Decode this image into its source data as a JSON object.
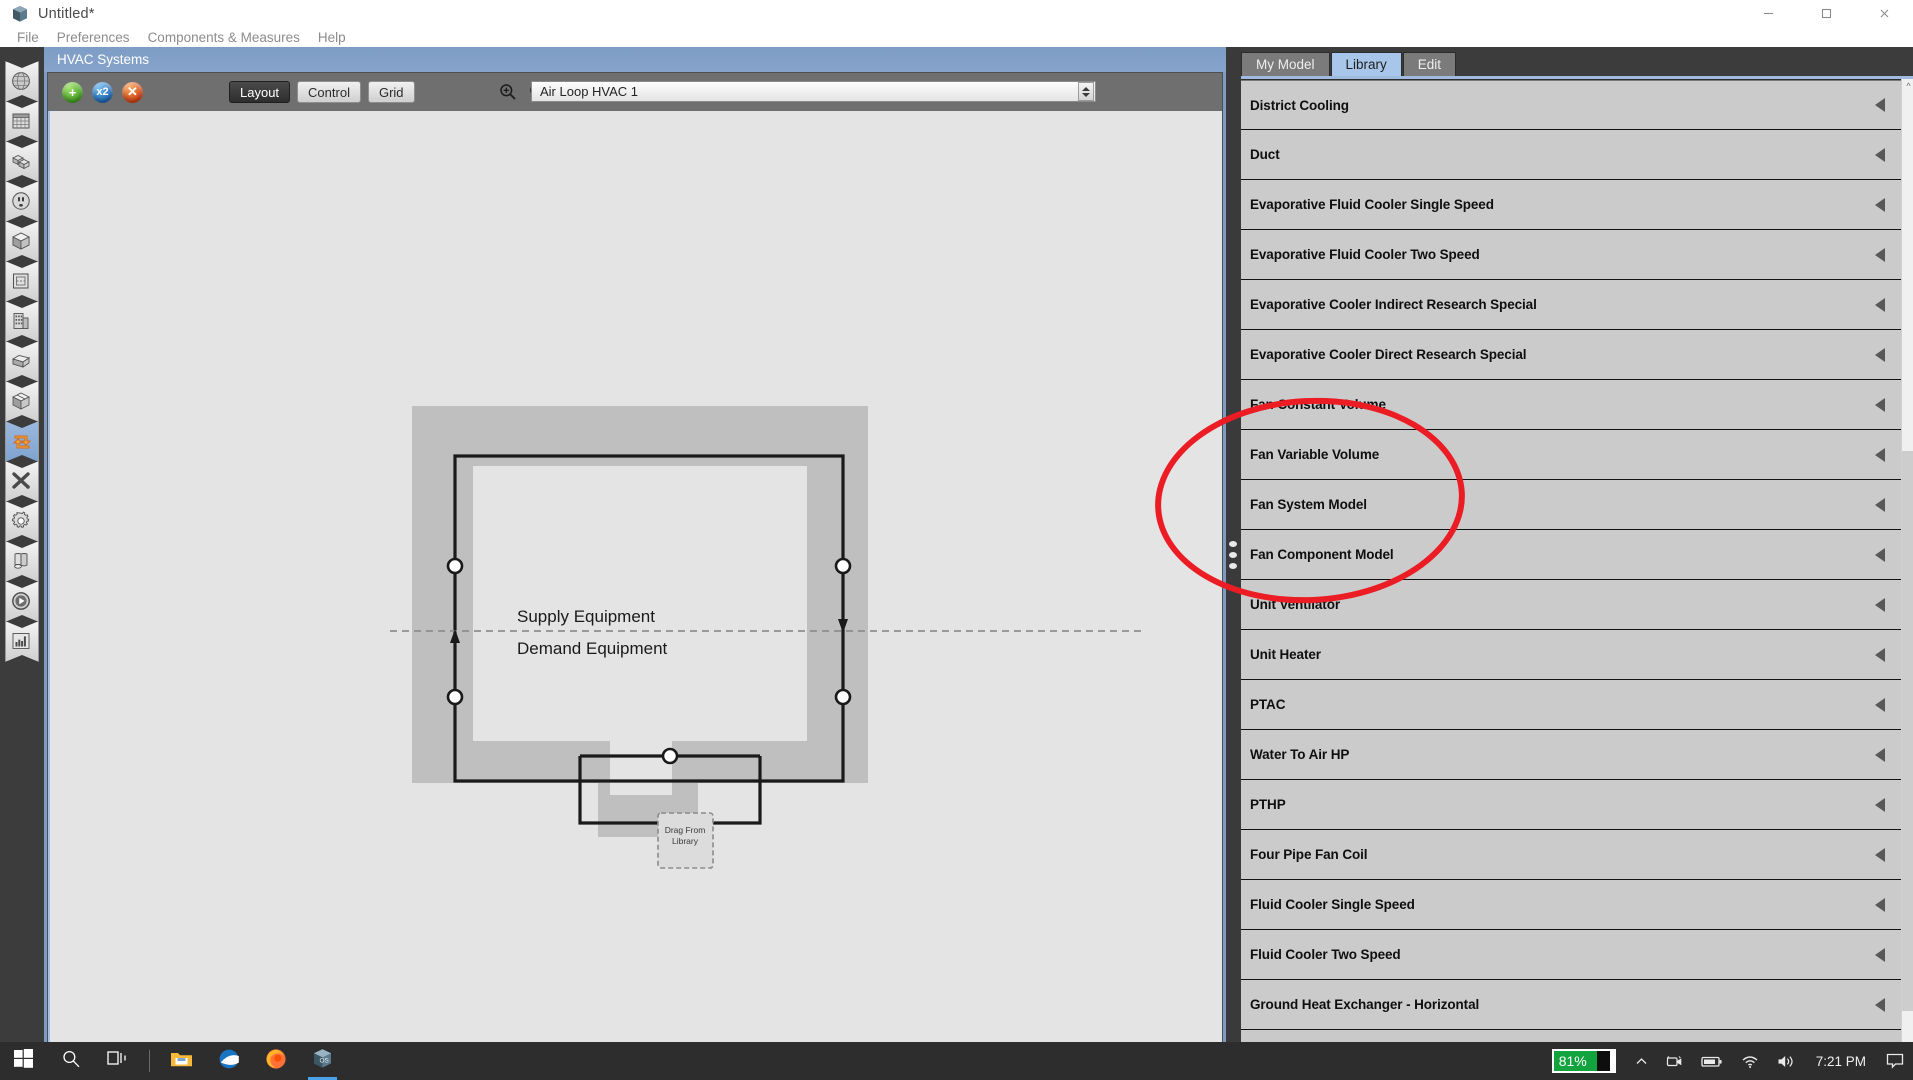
{
  "window": {
    "title": "Untitled*",
    "app_icon": "openstudio-cube-icon",
    "controls": {
      "minimize": "—",
      "maximize": "☐",
      "close": "✕"
    }
  },
  "menubar": {
    "items": [
      {
        "label": "File",
        "name": "menu-file"
      },
      {
        "label": "Preferences",
        "name": "menu-preferences"
      },
      {
        "label": "Components & Measures",
        "name": "menu-components-measures"
      },
      {
        "label": "Help",
        "name": "menu-help"
      }
    ]
  },
  "rail": {
    "items": [
      {
        "name": "sidebar-item-site",
        "icon": "globe-icon",
        "active": false
      },
      {
        "name": "sidebar-item-schedules",
        "icon": "calendar-icon",
        "active": false
      },
      {
        "name": "sidebar-item-constructions",
        "icon": "blocks-icon",
        "active": false
      },
      {
        "name": "sidebar-item-loads",
        "icon": "outlet-icon",
        "active": false
      },
      {
        "name": "sidebar-item-space-types",
        "icon": "cube-grid-icon",
        "active": false
      },
      {
        "name": "sidebar-item-geometry",
        "icon": "floorplan-icon",
        "active": false
      },
      {
        "name": "sidebar-item-facility",
        "icon": "building-icon",
        "active": false
      },
      {
        "name": "sidebar-item-spaces",
        "icon": "box-icon",
        "active": false
      },
      {
        "name": "sidebar-item-thermal-zones",
        "icon": "cube-split-icon",
        "active": false
      },
      {
        "name": "sidebar-item-hvac-systems",
        "icon": "loop-arrows-icon",
        "active": true
      },
      {
        "name": "sidebar-item-measures",
        "icon": "x-tool-icon",
        "active": false
      },
      {
        "name": "sidebar-item-simulation-settings",
        "icon": "gear-icon",
        "active": false
      },
      {
        "name": "sidebar-item-output-variables",
        "icon": "scroll-icon",
        "active": false
      },
      {
        "name": "sidebar-item-run-simulation",
        "icon": "play-icon",
        "active": false
      },
      {
        "name": "sidebar-item-results-summary",
        "icon": "bar-chart-icon",
        "active": false
      }
    ]
  },
  "hvac": {
    "panel_title": "HVAC Systems",
    "toolbar": {
      "add_label": "+",
      "copy_label": "x2",
      "delete_label": "✕",
      "views": [
        {
          "label": "Layout",
          "active": true
        },
        {
          "label": "Control",
          "active": false
        },
        {
          "label": "Grid",
          "active": false
        }
      ],
      "zoom_in": "zoom-in-icon",
      "zoom_out": "zoom-out-icon",
      "loop_selector_value": "Air Loop HVAC 1"
    },
    "diagram": {
      "supply_label": "Supply Equipment",
      "demand_label": "Demand Equipment",
      "drop_zone_line1": "Drag From",
      "drop_zone_line2": "Library"
    }
  },
  "library": {
    "tabs": [
      {
        "label": "My Model",
        "active": false
      },
      {
        "label": "Library",
        "active": true
      },
      {
        "label": "Edit",
        "active": false
      }
    ],
    "items": [
      {
        "label": "District Cooling"
      },
      {
        "label": "Duct"
      },
      {
        "label": "Evaporative Fluid Cooler Single Speed"
      },
      {
        "label": "Evaporative Fluid Cooler Two Speed"
      },
      {
        "label": "Evaporative Cooler Indirect Research Special"
      },
      {
        "label": "Evaporative Cooler Direct Research Special"
      },
      {
        "label": "Fan Constant Volume"
      },
      {
        "label": "Fan Variable Volume"
      },
      {
        "label": "Fan System Model"
      },
      {
        "label": "Fan Component Model"
      },
      {
        "label": "Unit Ventilator"
      },
      {
        "label": "Unit Heater"
      },
      {
        "label": "PTAC"
      },
      {
        "label": "Water To Air HP"
      },
      {
        "label": "PTHP"
      },
      {
        "label": "Four Pipe Fan Coil"
      },
      {
        "label": "Fluid Cooler Single Speed"
      },
      {
        "label": "Fluid Cooler Two Speed"
      },
      {
        "label": "Ground Heat Exchanger - Horizontal"
      }
    ]
  },
  "annotation": {
    "shape": "ellipse",
    "color": "#ec1c24",
    "target": "Fan Constant Volume / Fan Variable Volume / Fan System Model / Fan Component Model"
  },
  "taskbar": {
    "items": [
      {
        "name": "taskbar-start-button",
        "icon": "windows-logo-icon",
        "active": false
      },
      {
        "name": "taskbar-search-button",
        "icon": "search-icon",
        "active": false
      },
      {
        "name": "taskbar-task-view-button",
        "icon": "task-view-icon",
        "active": false
      },
      {
        "name": "taskbar-file-explorer",
        "icon": "folder-icon",
        "active": false
      },
      {
        "name": "taskbar-mail",
        "icon": "mail-icon",
        "active": false
      },
      {
        "name": "taskbar-firefox",
        "icon": "firefox-icon",
        "active": false
      },
      {
        "name": "taskbar-openstudio",
        "icon": "openstudio-cube-icon",
        "active": true
      }
    ],
    "tray": {
      "battery_percent": "81%",
      "chevron": "chevron-up-icon",
      "camera": "camera-icon",
      "battery": "battery-icon",
      "wifi": "wifi-icon",
      "volume": "volume-icon",
      "clock": "7:21 PM",
      "notifications": "notification-icon"
    }
  }
}
